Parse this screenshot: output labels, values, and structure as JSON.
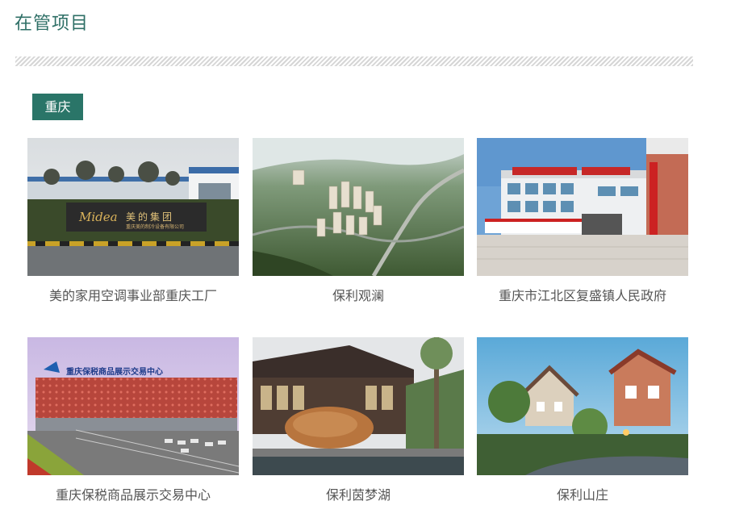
{
  "section": {
    "title": "在管项目",
    "region_tag": "重庆"
  },
  "projects": [
    {
      "name": "美的家用空调事业部重庆工厂",
      "sign_text": "美的集团",
      "sign_brand": "Midea",
      "sign_sub": "重庆美的制冷设备有限公司"
    },
    {
      "name": "保利观澜"
    },
    {
      "name": "重庆市江北区复盛镇人民政府"
    },
    {
      "name": "重庆保税商品展示交易中心",
      "sign_text": "重庆保税商品展示交易中心"
    },
    {
      "name": "保利茵梦湖"
    },
    {
      "name": "保利山庄"
    }
  ],
  "colors": {
    "accent": "#2a7568",
    "title": "#2e6f66",
    "caption": "#555555"
  }
}
